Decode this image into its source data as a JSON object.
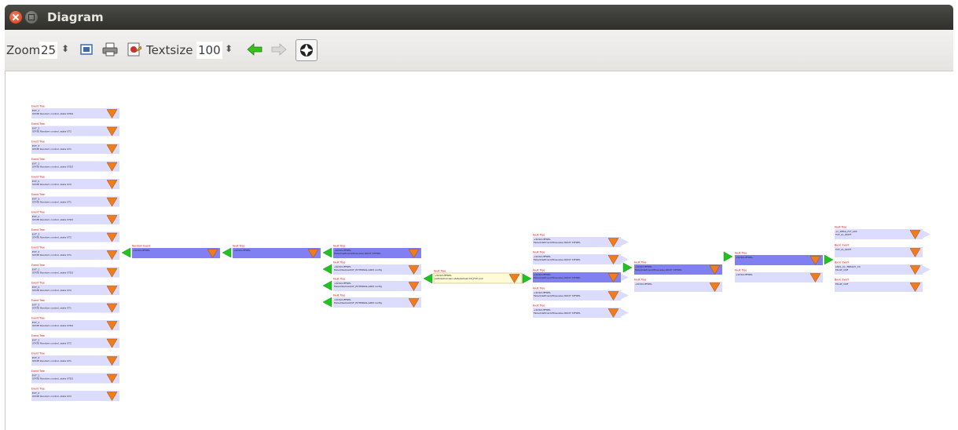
{
  "window": {
    "title": "Diagram"
  },
  "toolbar": {
    "zoom_label": "Zoom",
    "zoom_value": "25",
    "textsize_label": "Textsize",
    "textsize_value": "100",
    "icons": [
      "fit-to-window-icon",
      "print-icon",
      "export-image-icon",
      "back-arrow-icon",
      "forward-arrow-icon",
      "color-toggle-icon"
    ]
  },
  "colors": {
    "node_light": "#dcdcff",
    "node_dark": "#8080f0",
    "node_highlight": "#fffbd6",
    "triangle": "#f07c1c",
    "connector_green": "#22c222",
    "label_red": "#d00000"
  },
  "diagram": {
    "event_tree_label": "Event Tree",
    "fault_tree_label": "Fault Tree",
    "random_event_label": "Random Event",
    "basic_event_label": "Basic Event",
    "event_lines": [
      "EVT_1 - STATE Random control, state STD2",
      "EVT_2 - STATE Random control, state ST2",
      "EVT_3 - STATE Random control, state ST1"
    ],
    "fault_lines": [
      "+SCSCUFFREL",
      "Failed/deficient/flowvalve ROOT STFREL",
      "Failed/bad/sat/UF_EXTERNAL/ARM config"
    ],
    "center_line": "path/subscreen-state/subset XX_FCP pull",
    "basic_lines": [
      "+L_RESG_FLT_A03",
      "TCF_CL_NOTF",
      "LNCL_CL_TREADY_CS",
      "FAULT_CNF"
    ]
  }
}
